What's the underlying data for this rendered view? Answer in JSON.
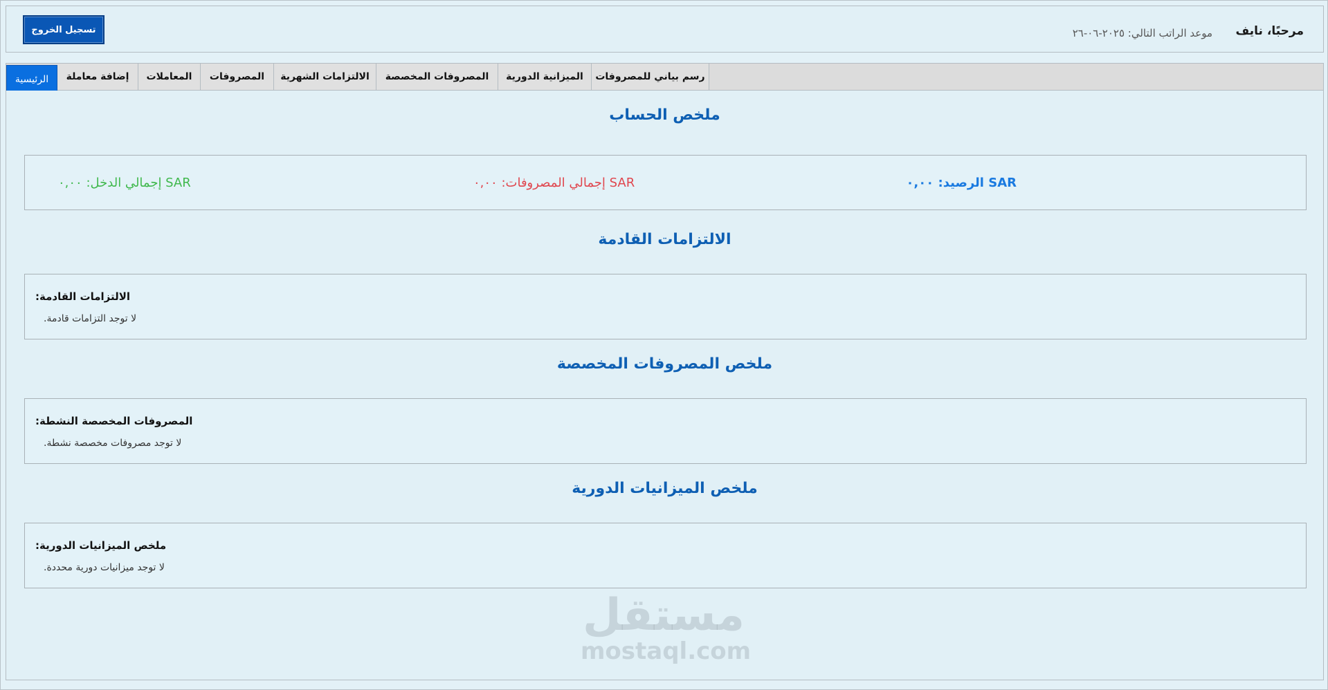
{
  "header": {
    "greeting": "مرحبًا، نايف",
    "next_salary": "موعد الراتب التالي: ٢٠٢٥-٠٦-٢٦",
    "logout_label": "تسجيل الخروج"
  },
  "tabs": [
    {
      "label": "الرئيسية",
      "active": true
    },
    {
      "label": "إضافة معاملة"
    },
    {
      "label": "المعاملات"
    },
    {
      "label": "المصروفات"
    },
    {
      "label": "الالتزامات الشهرية"
    },
    {
      "label": "المصروفات المخصصة"
    },
    {
      "label": "الميزانية الدورية"
    },
    {
      "label": "رسم بياني للمصروفات"
    }
  ],
  "summary": {
    "title": "ملخص الحساب",
    "balance": {
      "text": "SAR الرصيد: ٠,٠٠",
      "color": "#1a7ae0"
    },
    "expenses": {
      "text": "SAR إجمالي المصروفات: ٠,٠٠",
      "color": "#e0464e"
    },
    "income": {
      "text": "SAR إجمالي الدخل: ٠,٠٠",
      "color": "#3fb84c"
    }
  },
  "upcoming": {
    "title": "الالتزامات القادمة",
    "label": ":الالتزامات القادمة",
    "empty": ".لا توجد التزامات قادمة"
  },
  "custom_expenses": {
    "title": "ملخص المصروفات المخصصة",
    "label": ":المصروفات المخصصة النشطة",
    "empty": ".لا توجد مصروفات مخصصة نشطة"
  },
  "periodic_budgets": {
    "title": "ملخص الميزانيات الدورية",
    "label": ":ملخص الميزانيات الدورية",
    "empty": ".لا توجد ميزانيات دورية محددة"
  },
  "watermark": {
    "arabic": "مستقل",
    "latin": "mostaql.com"
  }
}
